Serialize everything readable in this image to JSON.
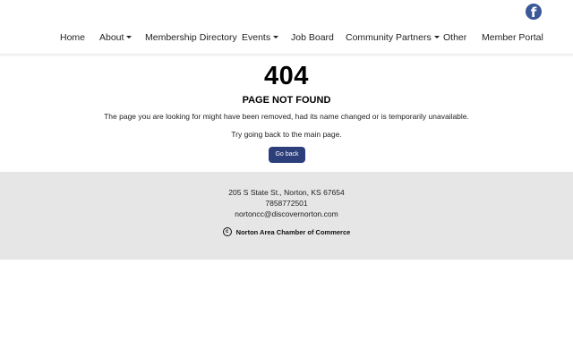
{
  "header": {
    "social": {
      "icon": "facebook-icon",
      "glyph": "f",
      "color": "#3b5998"
    },
    "nav": [
      {
        "label": "Home",
        "has_dropdown": false
      },
      {
        "label": "About",
        "has_dropdown": true
      },
      {
        "label": "Membership Directory",
        "has_dropdown": false
      },
      {
        "label": "Events",
        "has_dropdown": true
      },
      {
        "label": "Job Board",
        "has_dropdown": false
      },
      {
        "label": "Community Partners",
        "has_dropdown": true
      },
      {
        "label": "Other",
        "has_dropdown": false
      },
      {
        "label": "Member Portal",
        "has_dropdown": false
      }
    ]
  },
  "error": {
    "code": "404",
    "title": "PAGE NOT FOUND",
    "message": "The page you are looking for might have been removed, had its name changed or is temporarily unavailable.",
    "hint": "Try going back to the main page.",
    "button_label": "Go back",
    "button_color": "#2d3f7a"
  },
  "footer": {
    "address": "205 S State St., Norton, KS 67654",
    "phone": "7858772501",
    "email": "nortoncc@discovernorton.com",
    "copyright_symbol": "c",
    "organization": "Norton Area Chamber of Commerce",
    "background": "#e6e6e6"
  }
}
